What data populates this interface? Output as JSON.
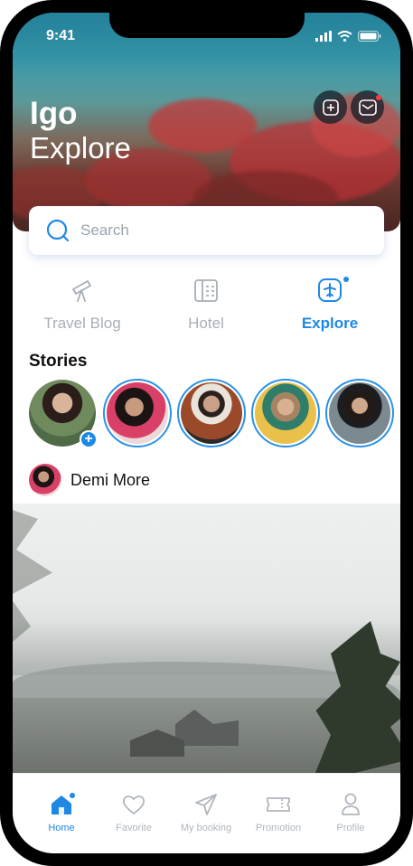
{
  "status": {
    "time": "9:41"
  },
  "header": {
    "title": "Igo",
    "subtitle": "Explore"
  },
  "search": {
    "placeholder": "Search"
  },
  "categories": [
    {
      "label": "Travel Blog",
      "icon": "telescope-icon"
    },
    {
      "label": "Hotel",
      "icon": "hotel-building-icon"
    },
    {
      "label": "Explore",
      "icon": "airplane-badge-icon",
      "active": true
    }
  ],
  "stories": {
    "title": "Stories"
  },
  "post": {
    "author": "Demi More"
  },
  "tabbar": [
    {
      "label": "Home",
      "icon": "home-icon",
      "active": true
    },
    {
      "label": "Favorite",
      "icon": "heart-icon"
    },
    {
      "label": "My booking",
      "icon": "send-icon"
    },
    {
      "label": "Promotion",
      "icon": "ticket-icon"
    },
    {
      "label": "Profile",
      "icon": "user-icon"
    }
  ],
  "colors": {
    "accent": "#1e88e5",
    "inactive": "#b0b6bd",
    "notification": "#ff3b3b"
  }
}
